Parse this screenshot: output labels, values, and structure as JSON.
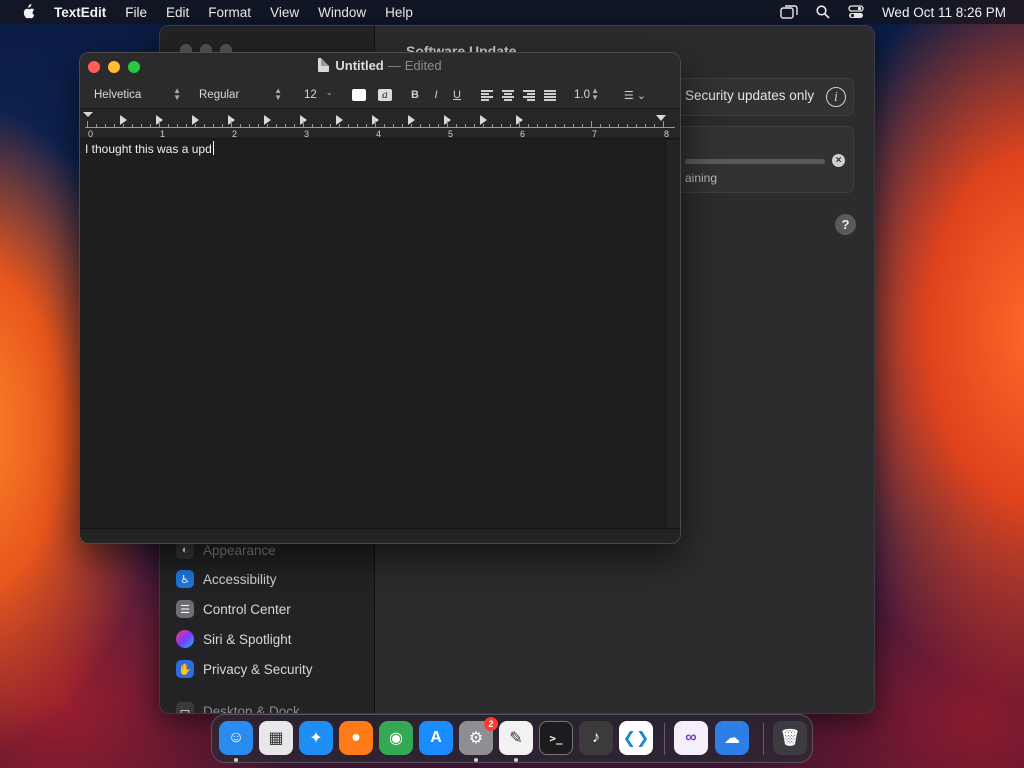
{
  "menubar": {
    "app_name": "TextEdit",
    "items": [
      "File",
      "Edit",
      "Format",
      "View",
      "Window",
      "Help"
    ],
    "clock": "Wed Oct 11  8:26 PM"
  },
  "settings_window": {
    "title": "Software Update",
    "sidebar_items": [
      {
        "label": "Appearance",
        "color": "#3a3a3c"
      },
      {
        "label": "Accessibility",
        "color": "#1f7ae0"
      },
      {
        "label": "Control Center",
        "color": "#6e6e73"
      },
      {
        "label": "Siri & Spotlight",
        "color": "#c02bd1"
      },
      {
        "label": "Privacy & Security",
        "color": "#2f6be0"
      },
      {
        "label": "Desktop & Dock",
        "color": "#3a3a3c"
      }
    ],
    "security_label": "Security updates only",
    "remaining_label": "aining"
  },
  "textedit": {
    "doc_name": "Untitled",
    "separator": "—",
    "status": "Edited",
    "toolbar": {
      "font_family": "Helvetica",
      "font_style": "Regular",
      "font_size": "12",
      "bold": "B",
      "italic": "I",
      "underline": "U",
      "line_spacing": "1.0"
    },
    "ruler_numbers": [
      "0",
      "1",
      "2",
      "3",
      "4",
      "5",
      "6",
      "7",
      "8"
    ],
    "body_text": "I thought this was a upd"
  },
  "dock": {
    "apps": [
      {
        "name": "Finder",
        "glyph": "☺",
        "color": "#2a8cf0",
        "running": true
      },
      {
        "name": "Launchpad",
        "glyph": "▦",
        "color": "#e8e8ea",
        "running": false
      },
      {
        "name": "Safari",
        "glyph": "✦",
        "color": "#1e8ef5",
        "running": false
      },
      {
        "name": "Firefox",
        "glyph": "●",
        "color": "#ff7a18",
        "running": false
      },
      {
        "name": "Chrome",
        "glyph": "◉",
        "color": "#34a853",
        "running": false
      },
      {
        "name": "App Store",
        "glyph": "A",
        "color": "#1a8cff",
        "running": false
      },
      {
        "name": "System Settings",
        "glyph": "⚙",
        "color": "#8e8e93",
        "running": true,
        "badge": "2"
      },
      {
        "name": "TextEdit",
        "glyph": "✎",
        "color": "#f2f2f2",
        "running": true
      },
      {
        "name": "Terminal",
        "glyph": ">_",
        "color": "#1c1c1e",
        "running": false
      },
      {
        "name": "GarageBand",
        "glyph": "♪",
        "color": "#3b3b3b",
        "running": false
      },
      {
        "name": "VS Code",
        "glyph": "❮❯",
        "color": "#ffffff",
        "running": false
      },
      {
        "name": "Visual Studio",
        "glyph": "∞",
        "color": "#f4f0fb",
        "running": false
      },
      {
        "name": "Weather",
        "glyph": "☁",
        "color": "#2d7fe6",
        "running": false
      },
      {
        "name": "Trash",
        "glyph": "🗑",
        "color": "#3c3c40",
        "running": false
      }
    ]
  }
}
